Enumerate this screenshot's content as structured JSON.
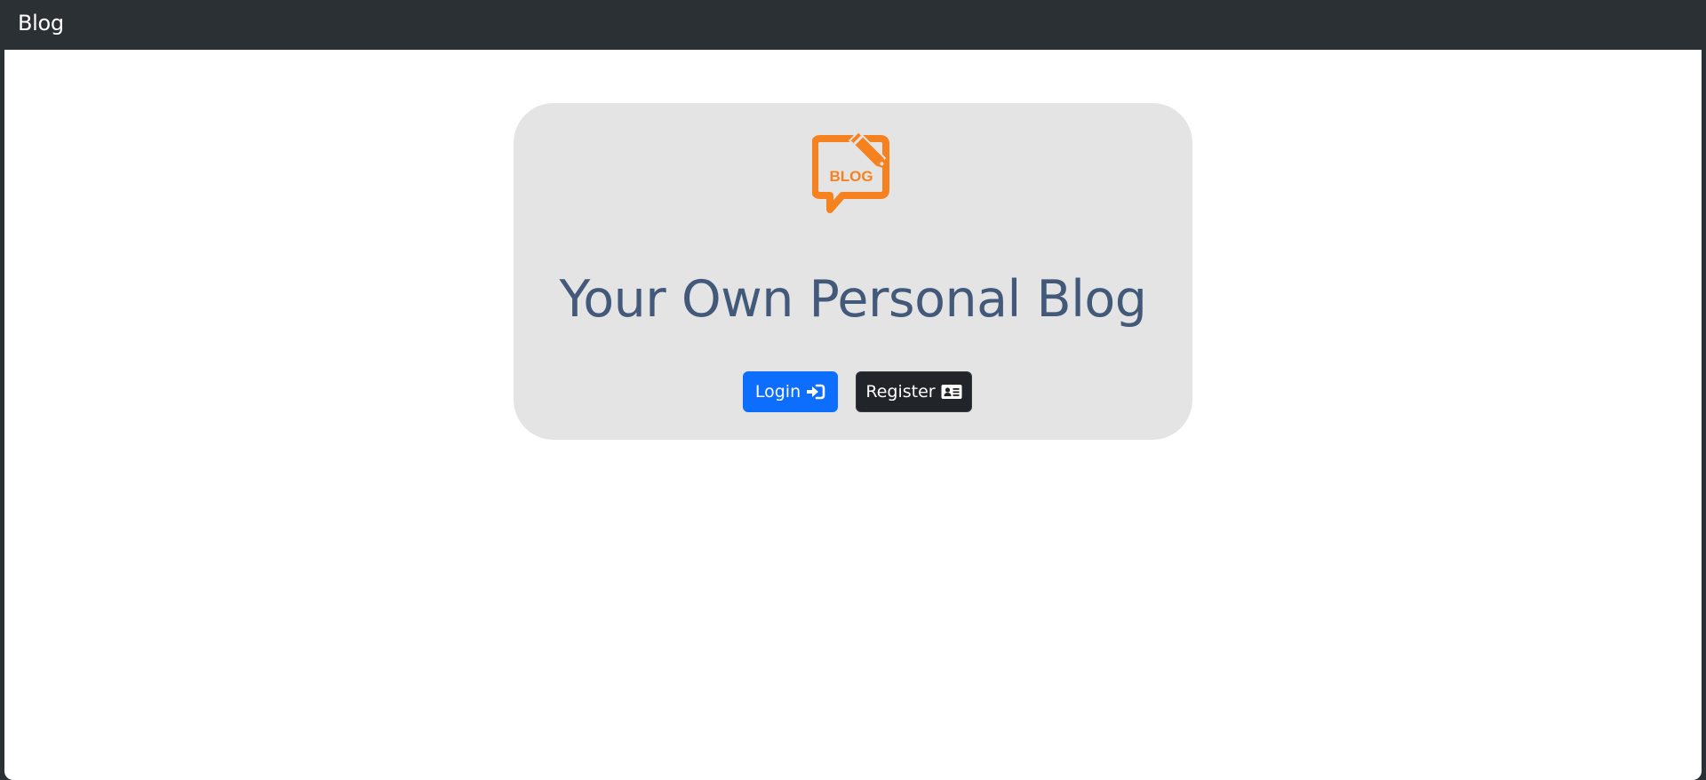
{
  "navbar": {
    "brand": "Blog"
  },
  "hero": {
    "logo_text": "BLOG",
    "logo_icon": "blog-speech-bubble-pencil-icon",
    "title": "Your Own Personal Blog",
    "login_label": "Login",
    "login_icon": "sign-in-icon",
    "register_label": "Register",
    "register_icon": "id-card-icon"
  },
  "colors": {
    "navbar_bg": "#2b3035",
    "hero_bg": "#e4e4e4",
    "title": "#42597a",
    "logo": "#f5821f",
    "login_bg": "#0d6efd",
    "register_bg": "#212529"
  }
}
